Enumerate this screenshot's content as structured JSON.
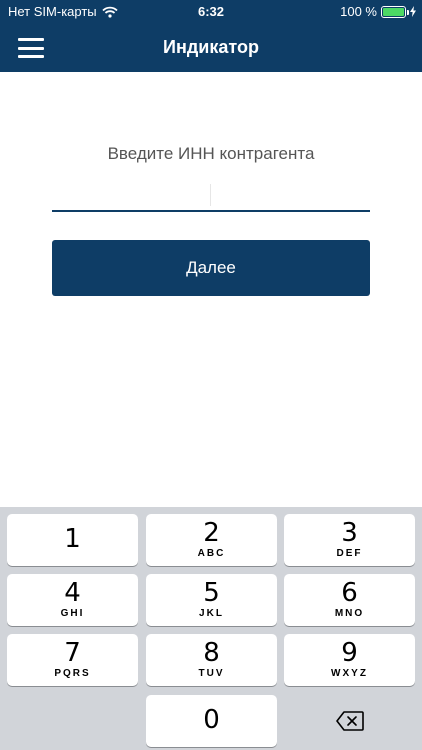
{
  "status_bar": {
    "carrier": "Нет SIM-карты",
    "time": "6:32",
    "battery": "100 %"
  },
  "nav": {
    "title": "Индикатор"
  },
  "form": {
    "prompt": "Введите ИНН контрагента",
    "input_value": "",
    "submit_label": "Далее"
  },
  "keypad": {
    "keys": [
      {
        "digit": "1",
        "letters": ""
      },
      {
        "digit": "2",
        "letters": "ABC"
      },
      {
        "digit": "3",
        "letters": "DEF"
      },
      {
        "digit": "4",
        "letters": "GHI"
      },
      {
        "digit": "5",
        "letters": "JKL"
      },
      {
        "digit": "6",
        "letters": "MNO"
      },
      {
        "digit": "7",
        "letters": "PQRS"
      },
      {
        "digit": "8",
        "letters": "TUV"
      },
      {
        "digit": "9",
        "letters": "WXYZ"
      },
      {
        "digit": "0",
        "letters": ""
      }
    ]
  },
  "icons": {
    "wifi": "wifi-icon",
    "charging": "charging-bolt-icon",
    "menu": "hamburger-menu-icon",
    "delete": "backspace-icon"
  },
  "colors": {
    "brand": "#0e3d66",
    "keyboard_background": "#d1d4d9",
    "battery_fill": "#4cd964"
  }
}
